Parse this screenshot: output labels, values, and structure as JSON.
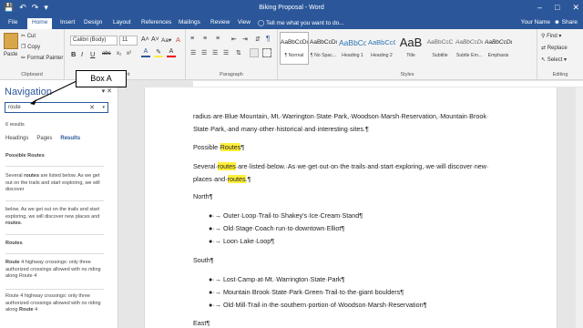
{
  "titlebar": {
    "title": "Biking Proposal - Word",
    "qat": [
      "💾",
      "↶",
      "↷",
      "▾"
    ],
    "win_buttons": [
      "–",
      "□",
      "✕"
    ]
  },
  "tabs": [
    "File",
    "Home",
    "Insert",
    "Design",
    "Layout",
    "References",
    "Mailings",
    "Review",
    "View"
  ],
  "active_tab": "Home",
  "tell_me": "Tell me what you want to do...",
  "user_name": "Your Name",
  "share": "Share",
  "ribbon": {
    "clipboard": {
      "paste": "Paste",
      "cut": "Cut",
      "copy": "Copy",
      "format_painter": "Format Painter",
      "label": "Clipboard"
    },
    "font": {
      "name": "Calibri (Body)",
      "size": "11",
      "label": "Font",
      "buttons": [
        "B",
        "I",
        "U",
        "abc",
        "x₂",
        "x²"
      ],
      "grow": "A˄",
      "shrink": "A˅",
      "case": "Aa▾",
      "clear": "A"
    },
    "paragraph": {
      "label": "Paragraph"
    },
    "styles": {
      "label": "Styles",
      "items": [
        {
          "preview": "AaBbCcDc",
          "name": "¶ Normal"
        },
        {
          "preview": "AaBbCcDc",
          "name": "¶ No Spac..."
        },
        {
          "preview": "AaBbCc",
          "name": "Heading 1"
        },
        {
          "preview": "AaBbCcC",
          "name": "Heading 2"
        },
        {
          "preview": "AaB",
          "name": "Title"
        },
        {
          "preview": "AaBbCcC",
          "name": "Subtitle"
        },
        {
          "preview": "AaBbCcDd",
          "name": "Subtle Em..."
        },
        {
          "preview": "AaBbCcDd",
          "name": "Emphasis"
        }
      ]
    },
    "editing": {
      "find": "Find",
      "replace": "Replace",
      "select": "Select",
      "label": "Editing"
    }
  },
  "nav": {
    "title": "Navigation",
    "search_value": "route",
    "result_count": "6 results",
    "tabs": [
      "Headings",
      "Pages",
      "Results"
    ],
    "active_tab": "Results"
  },
  "callout": {
    "label": "Box A"
  },
  "nav_results": [
    {
      "pre": "Possible ",
      "hit": "Route",
      "post": "s",
      "bold": true
    },
    {
      "pre": "Several ",
      "hit": "routes",
      "post": " are listed below. As we get out on the trails and start exploring, we will discover",
      "bold": false
    },
    {
      "pre": "below. As we get out on the trails and start exploring, we will discover new places and ",
      "hit": "routes",
      "post": ".",
      "bold": false
    },
    {
      "pre": "",
      "hit": "Route",
      "post": "s",
      "bold": true
    },
    {
      "pre": "",
      "hit": "Route",
      "post": " 4 highway crossings: only three authorized crossings allowed with no riding along Route 4",
      "bold": false
    },
    {
      "pre": "Route 4 highway crossings: only three authorized crossings allowed with no riding along ",
      "hit": "Route",
      "post": " 4",
      "bold": false
    }
  ],
  "document": {
    "line1": "radius·are·Blue·Mountain,·Mt.·Warrington·State·Park,·Woodson·Marsh·Reservation,·Mountain·Brook·",
    "line2": "State·Park,·and·many·other·historical·and·interesting·sites.¶",
    "possible_pre": "Possible·",
    "possible_hit": "Routes",
    "possible_post": "¶",
    "several_pre": "Several·",
    "several_hit": "routes",
    "several_post": "·are·listed·below.·As·we·get·out·on·the·trails·and·start·exploring,·we·will·discover·new·",
    "places_pre": "places·and·",
    "places_hit": "routes",
    "places_post": ".¶",
    "north": "North¶",
    "north_items": [
      "Outer·Loop·Trail·to·Shakey's·Ice·Cream·Stand¶",
      "Old·Stage·Coach·run·to·downtown·Elliot¶",
      "Loon·Lake·Loop¶"
    ],
    "south": "South¶",
    "south_items": [
      "Lost·Camp·at·Mt.·Warrington·State·Park¶",
      "Mountain·Brook·State·Park·Green·Trail·to·the·giant·boulders¶",
      "Old·Mill·Trail·in·the·southern·portion·of·Woodson·Marsh·Reservation¶"
    ],
    "east": "East¶",
    "bullet": "●·→"
  }
}
